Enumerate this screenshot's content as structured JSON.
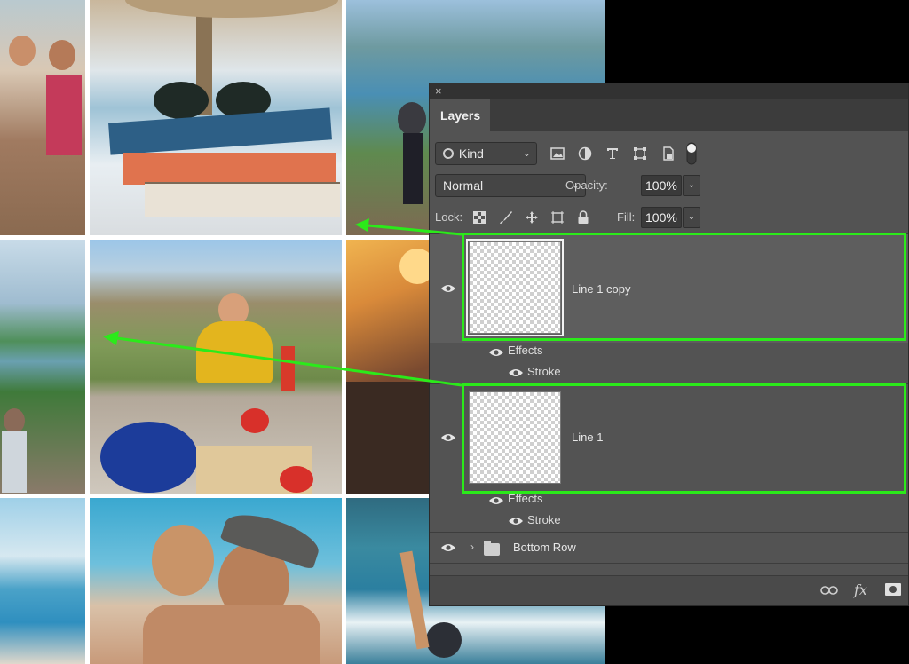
{
  "panel": {
    "close_glyph": "×",
    "tab_label": "Layers"
  },
  "filter_row": {
    "kind_label": "Kind",
    "kind_caret": "⌄",
    "icons": [
      "image-filter-icon",
      "adjustment-filter-icon",
      "type-filter-icon",
      "shape-filter-icon",
      "smart-object-filter-icon",
      "filter-toggle-icon"
    ]
  },
  "blend_row": {
    "blend_mode": "Normal",
    "opacity_label": "Opacity:",
    "opacity_value": "100%"
  },
  "lock_row": {
    "lock_label": "Lock:",
    "fill_label": "Fill:",
    "fill_value": "100%",
    "lock_icons": [
      "lock-transparent-icon",
      "lock-image-icon",
      "lock-position-icon",
      "lock-artboard-icon",
      "lock-all-icon"
    ]
  },
  "layers": [
    {
      "name": "Line 1 copy",
      "selected": true,
      "effects_label": "Effects",
      "effect_items": [
        "Stroke"
      ]
    },
    {
      "name": "Line 1",
      "selected": false,
      "effects_label": "Effects",
      "effect_items": [
        "Stroke"
      ]
    }
  ],
  "group": {
    "name": "Bottom Row",
    "expand_glyph": "›"
  },
  "footer": {
    "icons": [
      "link-layers-icon",
      "fx-icon",
      "add-mask-icon"
    ],
    "fx_text": "fx"
  },
  "colors": {
    "annotation_green": "#2bea1a",
    "panel_bg": "#535353",
    "selected_row_bg": "#5e5e5e"
  }
}
